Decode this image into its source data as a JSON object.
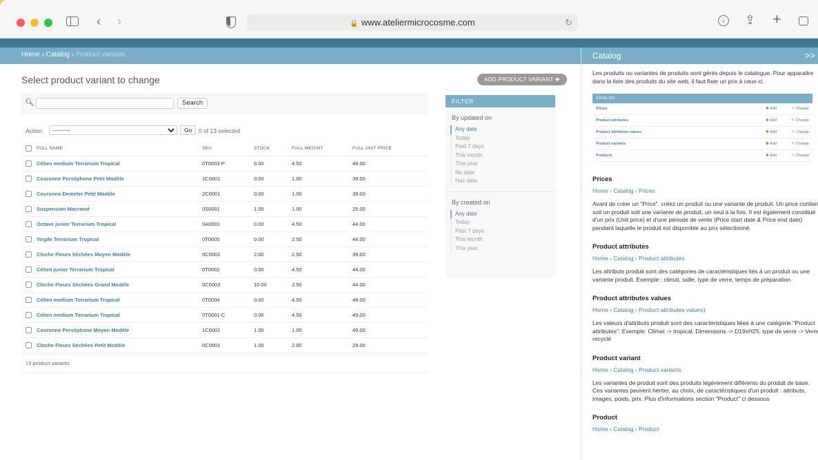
{
  "browser": {
    "url": "www.ateliermicrocosme.com"
  },
  "breadcrumb": {
    "home": "Home",
    "sep": "›",
    "catalog": "Catalog",
    "current": "Product variants"
  },
  "main": {
    "title": "Select product variant to change",
    "add_button": "ADD PRODUCT VARIANT",
    "search_button": "Search",
    "search_value": "",
    "action_label": "Action:",
    "action_selected": "---------",
    "go_button": "Go",
    "selected_count": "0 of 13 selected",
    "footer": "13 product variants"
  },
  "table": {
    "columns": [
      "FULL NAME",
      "SKU",
      "STOCK",
      "FULL WEIGHT",
      "FULL UNIT PRICE"
    ],
    "rows": [
      [
        "Célien medium Terrarium Tropical",
        "0T0003-P",
        "0.00",
        "4.50",
        "49.00"
      ],
      [
        "Couronne Perséphone Petit Modèle",
        "1C0001",
        "0.00",
        "1.00",
        "39.00"
      ],
      [
        "Couronne Demeter Petit Modèle",
        "2C0001",
        "0.00",
        "1.00",
        "39.00"
      ],
      [
        "Suspension Macramé",
        "0S0001",
        "1.00",
        "1.00",
        "25.00"
      ],
      [
        "Octave junior Terrarium Tropical",
        "0A0001",
        "0.00",
        "4.50",
        "44.00"
      ],
      [
        "Virgile Terrarium Tropical",
        "0T0005",
        "0.00",
        "2.50",
        "44.00"
      ],
      [
        "Cloche Fleurs Séchées Moyen Modèle",
        "0C0002",
        "2.00",
        "2.50",
        "39.00"
      ],
      [
        "Célien junior Terrarium Tropical",
        "0T0002",
        "0.00",
        "4.50",
        "44.00"
      ],
      [
        "Cloche Fleurs Séchées Grand Modèle",
        "0C0003",
        "10.00",
        "2.50",
        "44.00"
      ],
      [
        "Célien medium Terrarium Tropical",
        "0T0004",
        "0.00",
        "4.50",
        "49.00"
      ],
      [
        "Célien medium Terrarium Tropical",
        "0T0001-C",
        "0.00",
        "4.50",
        "49.00"
      ],
      [
        "Couronne Perséphone Moyen Modèle",
        "1C0002",
        "1.00",
        "1.00",
        "49.00"
      ],
      [
        "Cloche Fleurs Séchées Petit Modèle",
        "0C0001",
        "1.00",
        "2.00",
        "29.00"
      ]
    ]
  },
  "filter": {
    "title": "FILTER",
    "updated": {
      "heading": "By updated on",
      "options": [
        "Any date",
        "Today",
        "Past 7 days",
        "This month",
        "This year",
        "No date",
        "Has date"
      ]
    },
    "created": {
      "heading": "By created on",
      "options": [
        "Any date",
        "Today",
        "Past 7 days",
        "This month",
        "This year"
      ]
    }
  },
  "side": {
    "title": "Catalog",
    "expand": ">>",
    "intro": "Les produits ou variantes de produits sont gérés depuis le catalogue. Pour apparaitre dans la liste des produits du site web, il faut fixer un prix à ceux-ci.",
    "module_caption": "CATALOG",
    "module_rows": [
      "Prices",
      "Product attributes",
      "Product attributes values",
      "Product variants",
      "Products"
    ],
    "add_label": "Add",
    "change_label": "Change",
    "sections": [
      {
        "heading": "Prices",
        "crumb": "Home › Catalog › Prices",
        "text": "Avant de créer un \"Price\", créez un produit ou une variante de produit. Un price contient soit un produit soit une variante de produit, un seul à la fois. Il est également constitué d'un prix (Unit price) et d'une période de vente (Price start date & Price end date) pendant laquelle le produit est disponible au prix sélectionné."
      },
      {
        "heading": "Product attributes",
        "crumb": "Home › Catalog › Product attributes",
        "text": "Les attributs produit sont des catégories de caractéristiques liés à un produit ou une variante produit. Exemple : climat, taille, type de verre, temps de préparation"
      },
      {
        "heading": "Product attributes values",
        "crumb": "Home › Catalog › Product attributes values)",
        "text": "Les valeurs d'attributs produit sont des caractéristiques liées à une catégorie \"Product attributes\". Exemple: Climat -> tropical, Dimensions -> D19xH25, type de verre -> Verre recyclé"
      },
      {
        "heading": "Product variant",
        "crumb": "Home › Catalog › Product variants",
        "text": "Les variantes de produit sont des produits légèrement différents du produit de base. Ces variantes peuvent hériter, au choix, de caractéristiques d'un produit : attributs, images, poids, prix. Plus d'informations section \"Product\" ci dessous"
      },
      {
        "heading": "Product",
        "crumb": "Home › Catalog › Product",
        "text": ""
      }
    ]
  }
}
